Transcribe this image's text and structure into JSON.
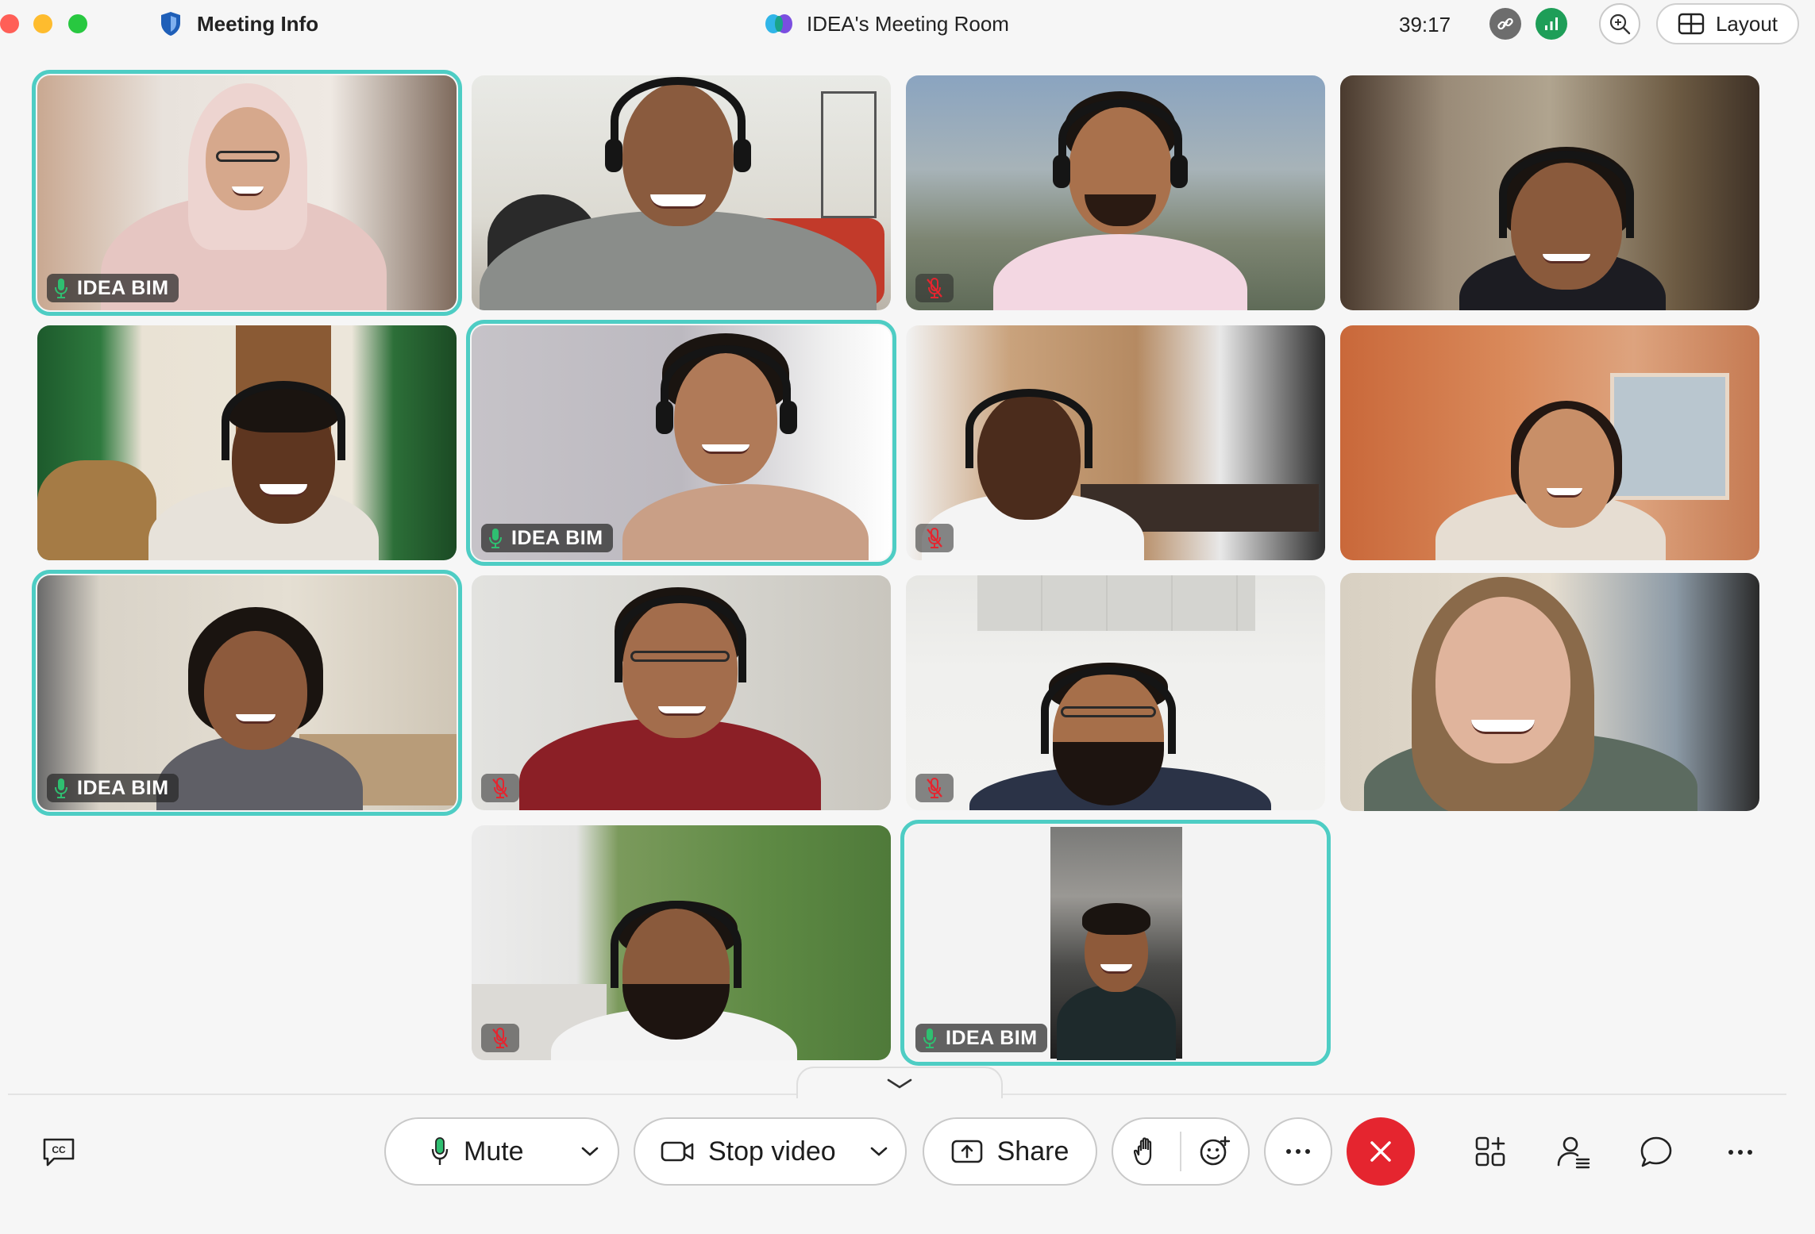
{
  "titlebar": {
    "meeting_info": "Meeting Info",
    "room_name": "IDEA's Meeting Room",
    "timer": "39:17",
    "layout_label": "Layout"
  },
  "participants": [
    {
      "label": "IDEA BIM",
      "muted": false,
      "active": true
    },
    {
      "label": "",
      "muted": false,
      "active": false
    },
    {
      "label": "",
      "muted": true,
      "active": false
    },
    {
      "label": "",
      "muted": false,
      "active": false
    },
    {
      "label": "",
      "muted": false,
      "active": false
    },
    {
      "label": "IDEA BIM",
      "muted": false,
      "active": true
    },
    {
      "label": "",
      "muted": true,
      "active": false
    },
    {
      "label": "",
      "muted": false,
      "active": false
    },
    {
      "label": "IDEA BIM",
      "muted": false,
      "active": true
    },
    {
      "label": "",
      "muted": true,
      "active": false
    },
    {
      "label": "",
      "muted": true,
      "active": false
    },
    {
      "label": "",
      "muted": false,
      "active": false
    },
    {
      "label": "",
      "muted": true,
      "active": false
    },
    {
      "label": "IDEA BIM",
      "muted": false,
      "active": true
    }
  ],
  "controls": {
    "mute_label": "Mute",
    "video_label": "Stop video",
    "share_label": "Share"
  },
  "colors": {
    "accent_teal": "#4ecdc4",
    "end_call_red": "#e5252f",
    "unmuted_mic_green": "#2fbf71"
  }
}
